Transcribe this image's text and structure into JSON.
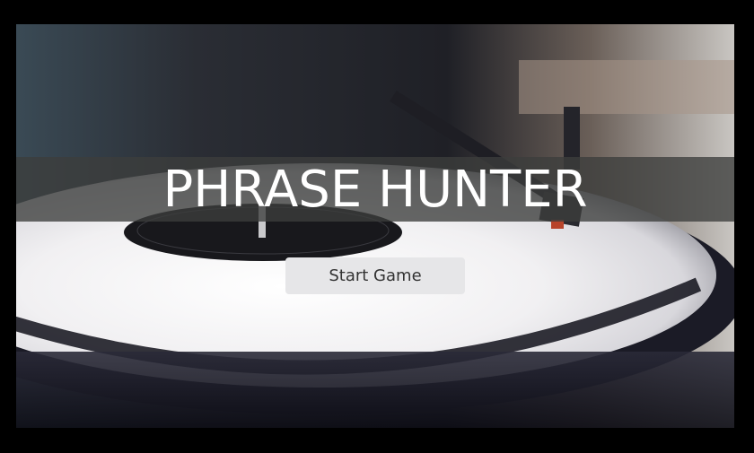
{
  "overlay": {
    "title": "PHRASE HUNTER",
    "start_button_label": "Start Game"
  },
  "background": {
    "description_icon": "vinyl-turntable-photo"
  },
  "colors": {
    "page_background": "#000000",
    "title_band": "#3c3e3c",
    "title_text": "#ffffff",
    "button_background": "#e6e6e8",
    "button_text": "#333333"
  }
}
